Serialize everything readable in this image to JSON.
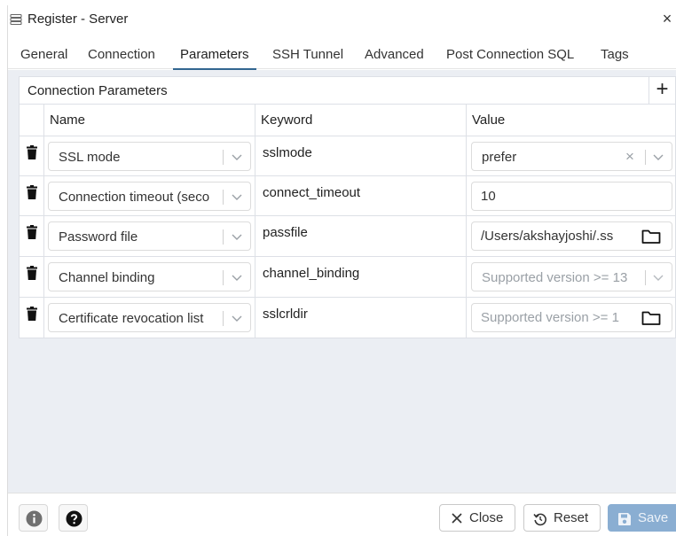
{
  "window": {
    "title": "Register - Server",
    "close_glyph": "×"
  },
  "tabs": [
    {
      "label": "General"
    },
    {
      "label": "Connection"
    },
    {
      "label": "Parameters",
      "active": true
    },
    {
      "label": "SSH Tunnel"
    },
    {
      "label": "Advanced"
    },
    {
      "label": "Post Connection SQL"
    },
    {
      "label": "Tags"
    }
  ],
  "panel": {
    "title": "Connection Parameters",
    "add_glyph": "+",
    "columns": {
      "name": "Name",
      "keyword": "Keyword",
      "value": "Value"
    },
    "rows": [
      {
        "name": "SSL mode",
        "keyword": "sslmode",
        "value": "prefer",
        "value_type": "select-clearable"
      },
      {
        "name": "Connection timeout (seco",
        "keyword": "connect_timeout",
        "value": "10",
        "value_type": "text"
      },
      {
        "name": "Password file",
        "keyword": "passfile",
        "value": "/Users/akshayjoshi/.ss",
        "value_type": "file"
      },
      {
        "name": "Channel binding",
        "keyword": "channel_binding",
        "value": "Supported version >= 13",
        "value_type": "select-disabled"
      },
      {
        "name": "Certificate revocation list",
        "keyword": "sslcrldir",
        "value": "Supported version >= 1",
        "value_type": "file-disabled"
      }
    ]
  },
  "footer": {
    "close_label": "Close",
    "reset_label": "Reset",
    "save_label": "Save"
  },
  "colors": {
    "accent": "#326690",
    "save_bg": "#8aaed2",
    "content_bg": "#ebeef3"
  },
  "icons": [
    "server-icon",
    "close-icon",
    "plus-icon",
    "trash-icon",
    "chevron-down-icon",
    "folder-icon",
    "info-icon",
    "help-icon",
    "reset-icon",
    "save-icon"
  ]
}
